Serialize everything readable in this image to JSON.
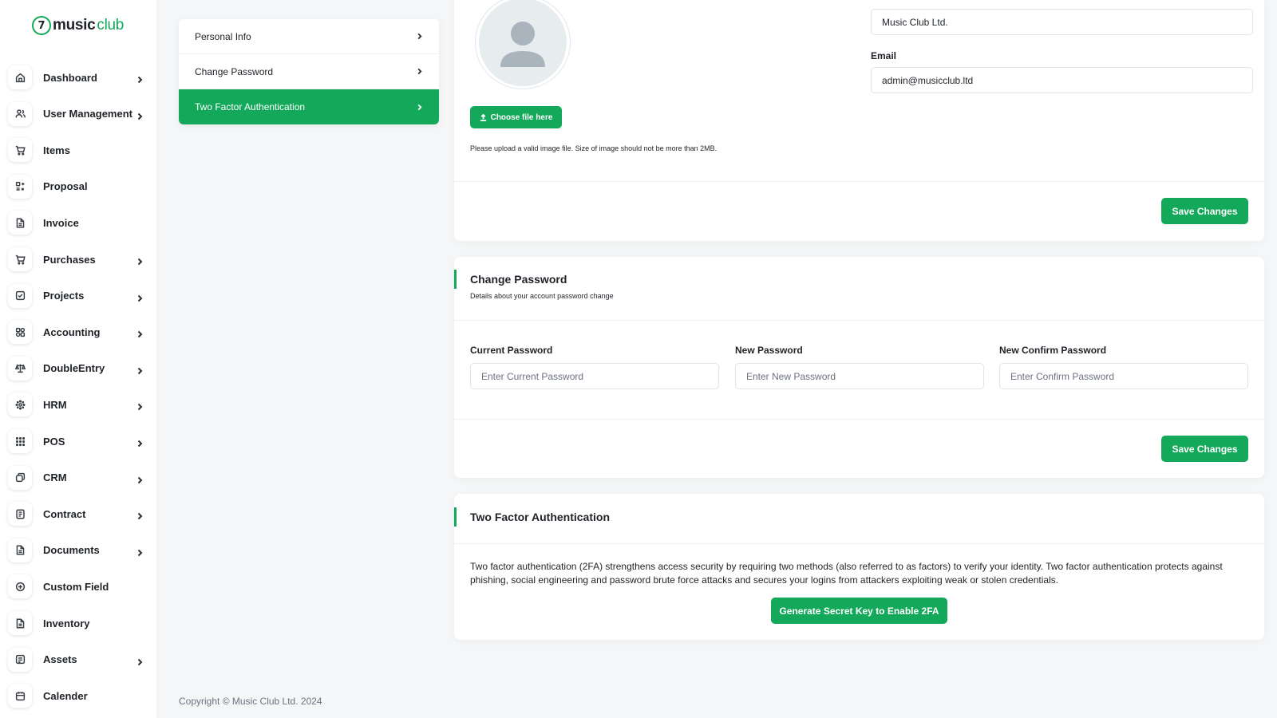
{
  "brand": {
    "logo_mark": "7",
    "logo_text_a": "music",
    "logo_text_b": "club",
    "accent": "#14a85a"
  },
  "sidebar": {
    "items": [
      {
        "label": "Dashboard",
        "icon": "home-icon",
        "has_children": true
      },
      {
        "label": "User Management",
        "icon": "users-icon",
        "has_children": true
      },
      {
        "label": "Items",
        "icon": "cart-icon",
        "has_children": false
      },
      {
        "label": "Proposal",
        "icon": "proposal-icon",
        "has_children": false
      },
      {
        "label": "Invoice",
        "icon": "file-icon",
        "has_children": false
      },
      {
        "label": "Purchases",
        "icon": "cart-icon",
        "has_children": true
      },
      {
        "label": "Projects",
        "icon": "checkbox-icon",
        "has_children": true
      },
      {
        "label": "Accounting",
        "icon": "grid-icon",
        "has_children": true
      },
      {
        "label": "DoubleEntry",
        "icon": "scale-icon",
        "has_children": true
      },
      {
        "label": "HRM",
        "icon": "hrm-icon",
        "has_children": true
      },
      {
        "label": "POS",
        "icon": "dots-grid-icon",
        "has_children": true
      },
      {
        "label": "CRM",
        "icon": "crm-icon",
        "has_children": true
      },
      {
        "label": "Contract",
        "icon": "contract-icon",
        "has_children": true
      },
      {
        "label": "Documents",
        "icon": "file-icon",
        "has_children": true
      },
      {
        "label": "Custom Field",
        "icon": "plus-circle-icon",
        "has_children": false
      },
      {
        "label": "Inventory",
        "icon": "file-icon",
        "has_children": false
      },
      {
        "label": "Assets",
        "icon": "assets-icon",
        "has_children": true
      },
      {
        "label": "Calender",
        "icon": "calendar-icon",
        "has_children": false
      }
    ]
  },
  "settings_menu": {
    "items": [
      {
        "label": "Personal Info",
        "active": false
      },
      {
        "label": "Change Password",
        "active": false
      },
      {
        "label": "Two Factor Authentication",
        "active": true
      }
    ]
  },
  "personal_info": {
    "choose_file_label": "Choose file here",
    "upload_hint": "Please upload a valid image file. Size of image should not be more than 2MB.",
    "full_name_value": "Music Club Ltd.",
    "email_label": "Email",
    "email_value": "admin@musicclub.ltd",
    "save_label": "Save Changes"
  },
  "change_password": {
    "title": "Change Password",
    "subtitle": "Details about your account password change",
    "current_label": "Current Password",
    "current_placeholder": "Enter Current Password",
    "new_label": "New Password",
    "new_placeholder": "Enter New Password",
    "confirm_label": "New Confirm Password",
    "confirm_placeholder": "Enter Confirm Password",
    "save_label": "Save Changes"
  },
  "two_factor": {
    "title": "Two Factor Authentication",
    "description": "Two factor authentication (2FA) strengthens access security by requiring two methods (also referred to as factors) to verify your identity. Two factor authentication protects against phishing, social engineering and password brute force attacks and secures your logins from attackers exploiting weak or stolen credentials.",
    "button_label": "Generate Secret Key to Enable 2FA"
  },
  "footer": {
    "copyright": "Copyright © Music Club Ltd. 2024"
  }
}
